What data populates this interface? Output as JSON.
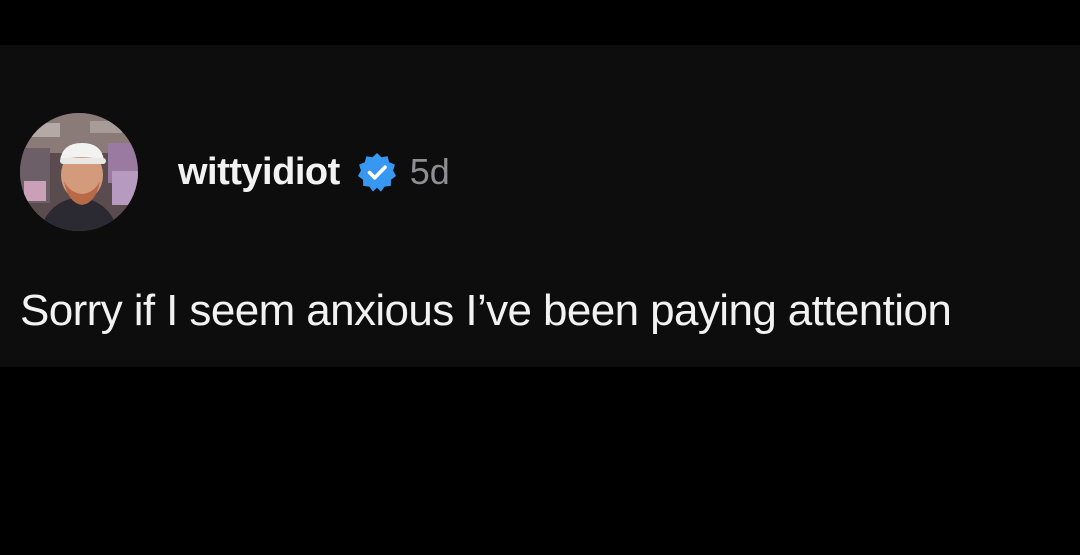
{
  "post": {
    "author": {
      "username": "wittyidiot",
      "verified": true,
      "verified_icon": "verified-badge-icon",
      "verified_color": "#3897f0",
      "avatar": "avatar-photo"
    },
    "timestamp": "5d",
    "text": "Sorry if I seem anxious I’ve been paying attention"
  },
  "colors": {
    "background": "#000000",
    "card": "#0d0d0e",
    "text_primary": "#f2f2f2",
    "text_secondary": "#8e8e93"
  }
}
